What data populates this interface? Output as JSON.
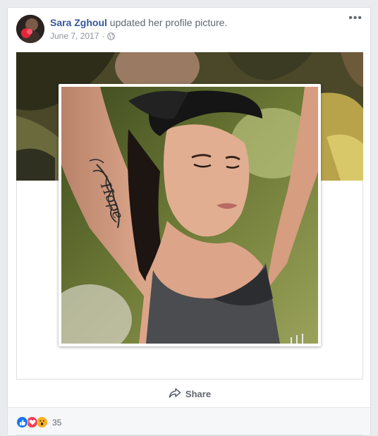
{
  "post": {
    "author": "Sara Zghoul",
    "action": "updated her profile picture.",
    "date": "June 7, 2017",
    "separator": "·",
    "more_label": "•••",
    "audience_icon": "globe-icon"
  },
  "actions": {
    "share_label": "Share",
    "share_icon": "share-arrow-icon"
  },
  "reactions": {
    "types": [
      "like",
      "love",
      "wow"
    ],
    "count": "35",
    "colors": {
      "like": "#1877f2",
      "love": "#f33e58",
      "wow": "#f7b125"
    }
  },
  "photo": {
    "tattoo_text": "Hope"
  }
}
